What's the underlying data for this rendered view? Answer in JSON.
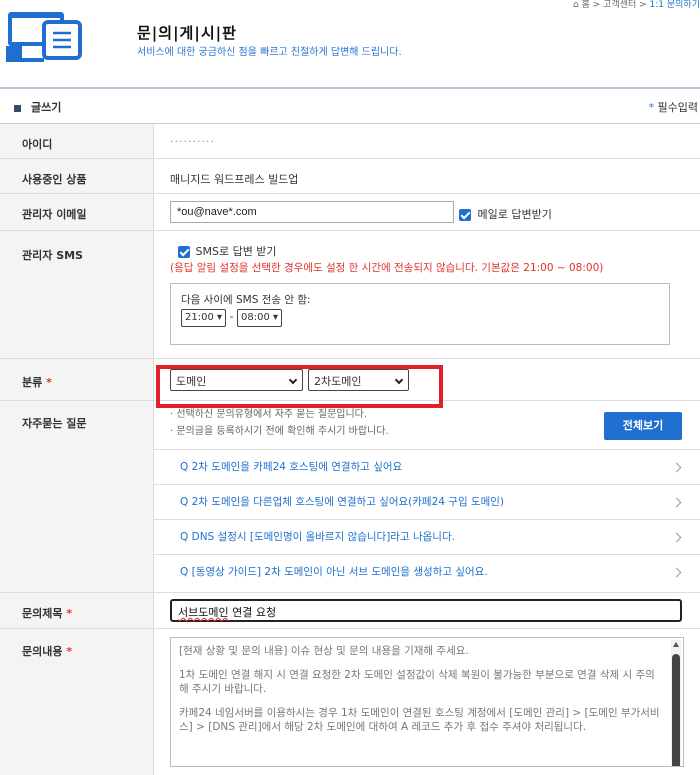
{
  "breadcrumb": {
    "items": [
      "홈",
      "고객센터"
    ],
    "current": "1:1 문의하기"
  },
  "header": {
    "title": "문|의|게|시|판",
    "subtitle": "서비스에 대한 궁금하신 점을 빠르고 친절하게 답변해 드립니다."
  },
  "write": {
    "label": "글쓰기",
    "required_star": "*",
    "required_label": "필수입력"
  },
  "form": {
    "id": {
      "label": "아이디",
      "value": "··········"
    },
    "product": {
      "label": "사용중인 상품",
      "value": "매니지드 워드프레스 빌드업"
    },
    "email": {
      "label": "관리자 이메일",
      "value": "*ou@nave*.com",
      "checkbox_label": "메일로 답변받기"
    },
    "sms": {
      "label": "관리자 SMS",
      "checkbox_label": "SMS로 답변 받기",
      "warning": "(응답 알림 설정을 선택한 경우에도 설정 한 시간에 전송되지 않습니다. 기본값은 21:00 ~ 08:00)",
      "quiet_label": "다음 사이에 SMS 전송 안 함:",
      "from": "21:00",
      "separator": "-",
      "to": "08:00"
    },
    "category": {
      "label": "분류",
      "star": "*",
      "primary": "도메인",
      "secondary": "2차도메인"
    },
    "faq": {
      "label": "자주묻는 질문",
      "notes": [
        "· 선택하신 문의유형에서 자주 묻는 질문입니다.",
        "· 문의글을 등록하시기 전에 확인해 주시기 바랍니다."
      ],
      "view_all": "전체보기",
      "items": [
        "Q 2차 도메인을 카페24 호스팅에 연결하고 싶어요",
        "Q 2차 도메인을 다른업체 호스팅에 연결하고 싶어요(카페24 구입 도메인)",
        "Q DNS 설정시 [도메인명이 올바르지 않습니다]라고 나옵니다.",
        "Q [동영상 가이드] 2차 도메인이 아닌 서브 도메인을 생성하고 싶어요."
      ]
    },
    "subject": {
      "label": "문의제목",
      "star": "*",
      "value_marked": "서브도메인",
      "value_rest": " 연결 요청"
    },
    "body": {
      "label": "문의내용",
      "star": "*",
      "paragraphs": [
        "[현재 상황 및 문의 내용] 이슈 현상 및 문의 내용을 기재해 주세요.",
        "1차 도메인 연결 해지 시 연결 요청한 2차 도메인 설정값이 삭제 복원이 불가능한 부분으로 연결 삭제 시 주의해 주시기 바랍니다.",
        "카페24 네임서버를 이용하시는 경우 1차 도메인이 연결된 호스팅 계정에서 [도메인 관리] > [도메인 부가서비스] > [DNS 관리]에서 해당 2차 도메인에 대하여 A 레코드 추가 후 접수 주셔야 처리됩니다."
      ]
    }
  },
  "colors": {
    "accent": "#1e6fd0",
    "required": "#e0332b",
    "highlight": "#e0202b"
  }
}
